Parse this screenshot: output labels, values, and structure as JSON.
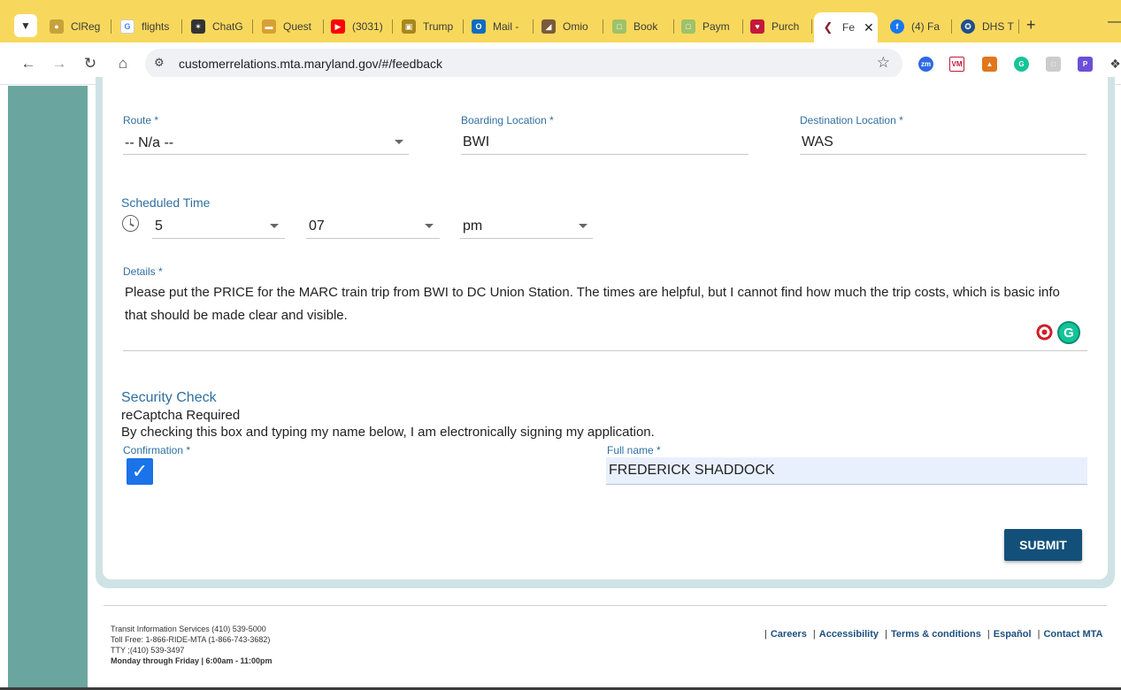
{
  "browser": {
    "tabs": [
      {
        "label": "ClReg",
        "icon": "globe-icon",
        "color": "#c7a23a"
      },
      {
        "label": "flights",
        "icon": "google-icon",
        "color": "#4285f4"
      },
      {
        "label": "ChatG",
        "icon": "chatgpt-icon",
        "color": "#333333"
      },
      {
        "label": "Quest",
        "icon": "card-icon",
        "color": "#d8a034"
      },
      {
        "label": "(3031)",
        "icon": "youtube-icon",
        "color": "#ff0000"
      },
      {
        "label": "Trump",
        "icon": "briefcase-icon",
        "color": "#a8861c"
      },
      {
        "label": "Mail -",
        "icon": "outlook-icon",
        "color": "#0f6cbd"
      },
      {
        "label": "Omio",
        "icon": "omio-icon",
        "color": "#7a5a3a"
      },
      {
        "label": "Book",
        "icon": "square-icon",
        "color": "#9ec26a"
      },
      {
        "label": "Paym",
        "icon": "square-icon",
        "color": "#9ec26a"
      },
      {
        "label": "Purch",
        "icon": "heart-icon",
        "color": "#c4183c"
      },
      {
        "label": "Fe",
        "icon": "amtrak-icon",
        "color": "#8a1c2c",
        "active": true
      },
      {
        "label": "(4) Fa",
        "icon": "facebook-icon",
        "color": "#1877f2"
      },
      {
        "label": "DHS T",
        "icon": "seal-icon",
        "color": "#1f4e8c"
      }
    ],
    "url": "customerrelations.mta.maryland.gov/#/feedback"
  },
  "form": {
    "route": {
      "label": "Route *",
      "value": "-- N/a --"
    },
    "boarding": {
      "label": "Boarding Location *",
      "value": "BWI"
    },
    "destination": {
      "label": "Destination Location *",
      "value": "WAS"
    },
    "scheduled_time": {
      "label": "Scheduled Time",
      "hour": "5",
      "minute": "07",
      "ampm": "pm"
    },
    "details": {
      "label": "Details *",
      "value": "Please put the PRICE for the MARC train trip from BWI to DC Union Station.   The times are helpful, but I cannot find how much the trip costs, which is basic info that should be made clear and visible."
    },
    "security": {
      "title": "Security Check",
      "recaptcha": "reCaptcha Required",
      "signing_text": "By checking this box and typing my name below, I am electronically signing my application.",
      "confirmation_label": "Confirmation *",
      "confirmation_checked": true,
      "fullname_label": "Full name *",
      "fullname_value": "FREDERICK SHADDOCK"
    },
    "submit_label": "SUBMIT"
  },
  "footer": {
    "info": [
      "Transit Information Services (410) 539-5000",
      "Toll Free: 1-866-RIDE-MTA (1-866-743-3682)",
      "TTY ;(410) 539-3497",
      "Monday through Friday | 6:00am - 11:00pm"
    ],
    "links": [
      "Careers",
      "Accessibility",
      "Terms & conditions",
      "Español",
      "Contact MTA"
    ]
  }
}
